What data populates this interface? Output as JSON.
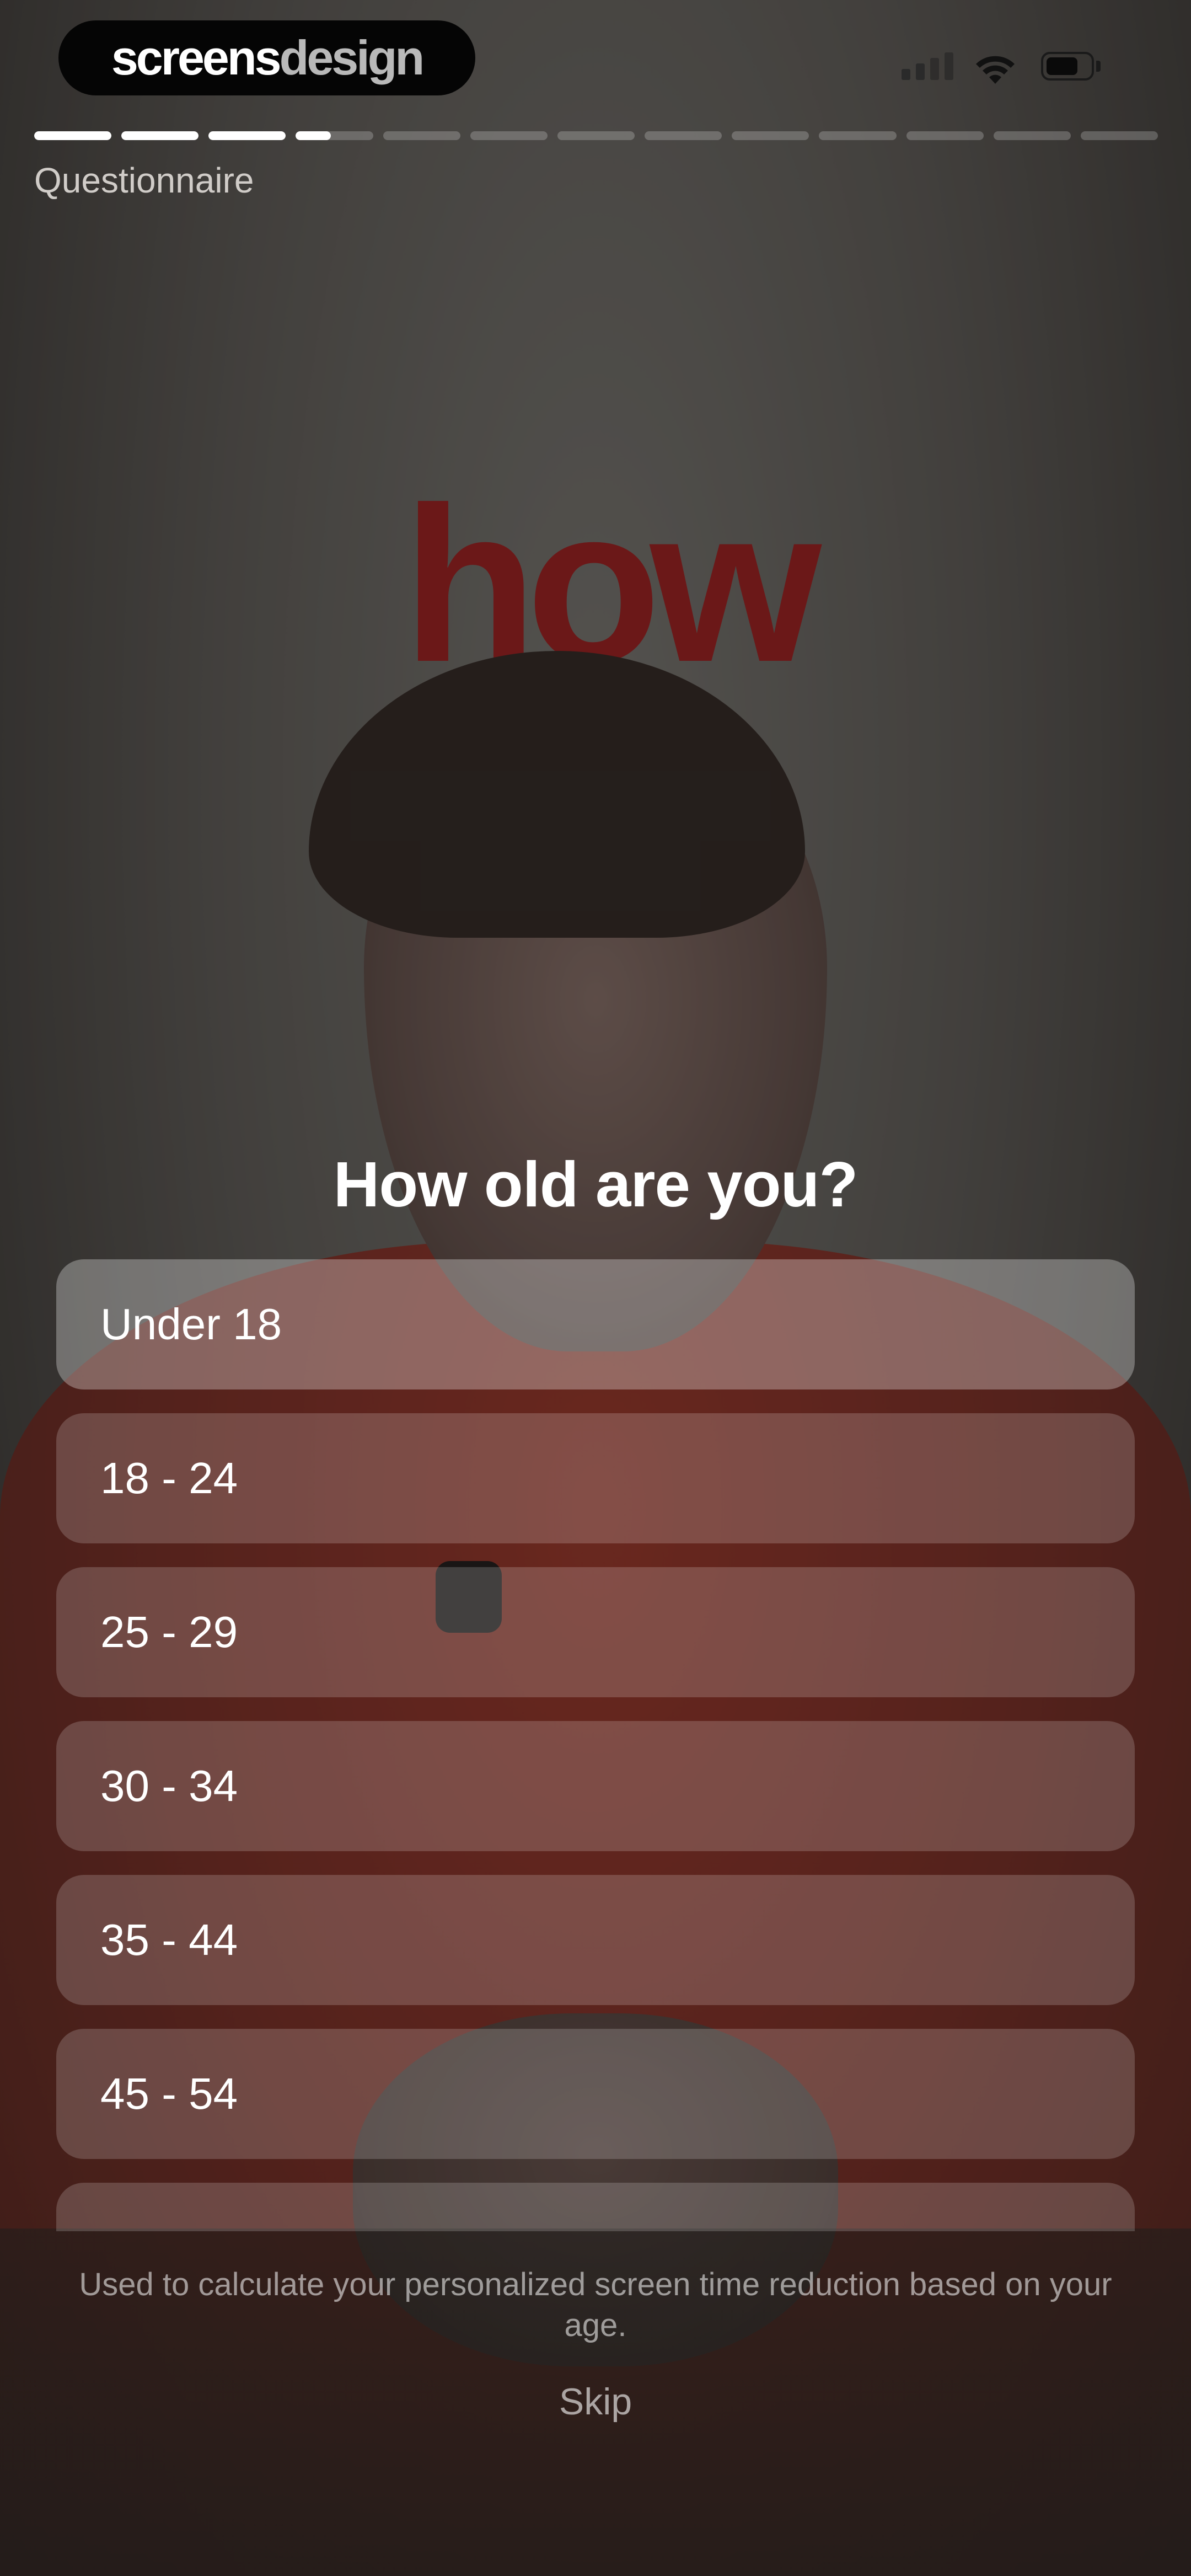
{
  "brand": {
    "part1": "screens",
    "part2": "design"
  },
  "background": {
    "poster_word": "how"
  },
  "progress": {
    "segments": 13,
    "completed": 3,
    "current_fraction": 0.45
  },
  "header": {
    "section_label": "Questionnaire"
  },
  "question": {
    "title": "How old are you?"
  },
  "options": [
    {
      "label": "Under 18"
    },
    {
      "label": "18 - 24"
    },
    {
      "label": "25 - 29"
    },
    {
      "label": "30 - 34"
    },
    {
      "label": "35 - 44"
    },
    {
      "label": "45 - 54"
    },
    {
      "label": ""
    }
  ],
  "footer": {
    "helper_text": "Used to calculate your personalized screen time reduction based on your age.",
    "skip_label": "Skip"
  },
  "icons": [
    "cellular-signal-icon",
    "wifi-icon",
    "battery-icon"
  ],
  "colors": {
    "accent": "#ffffff",
    "poster_red": "#8e1c1c",
    "sweater": "#8c3226"
  }
}
